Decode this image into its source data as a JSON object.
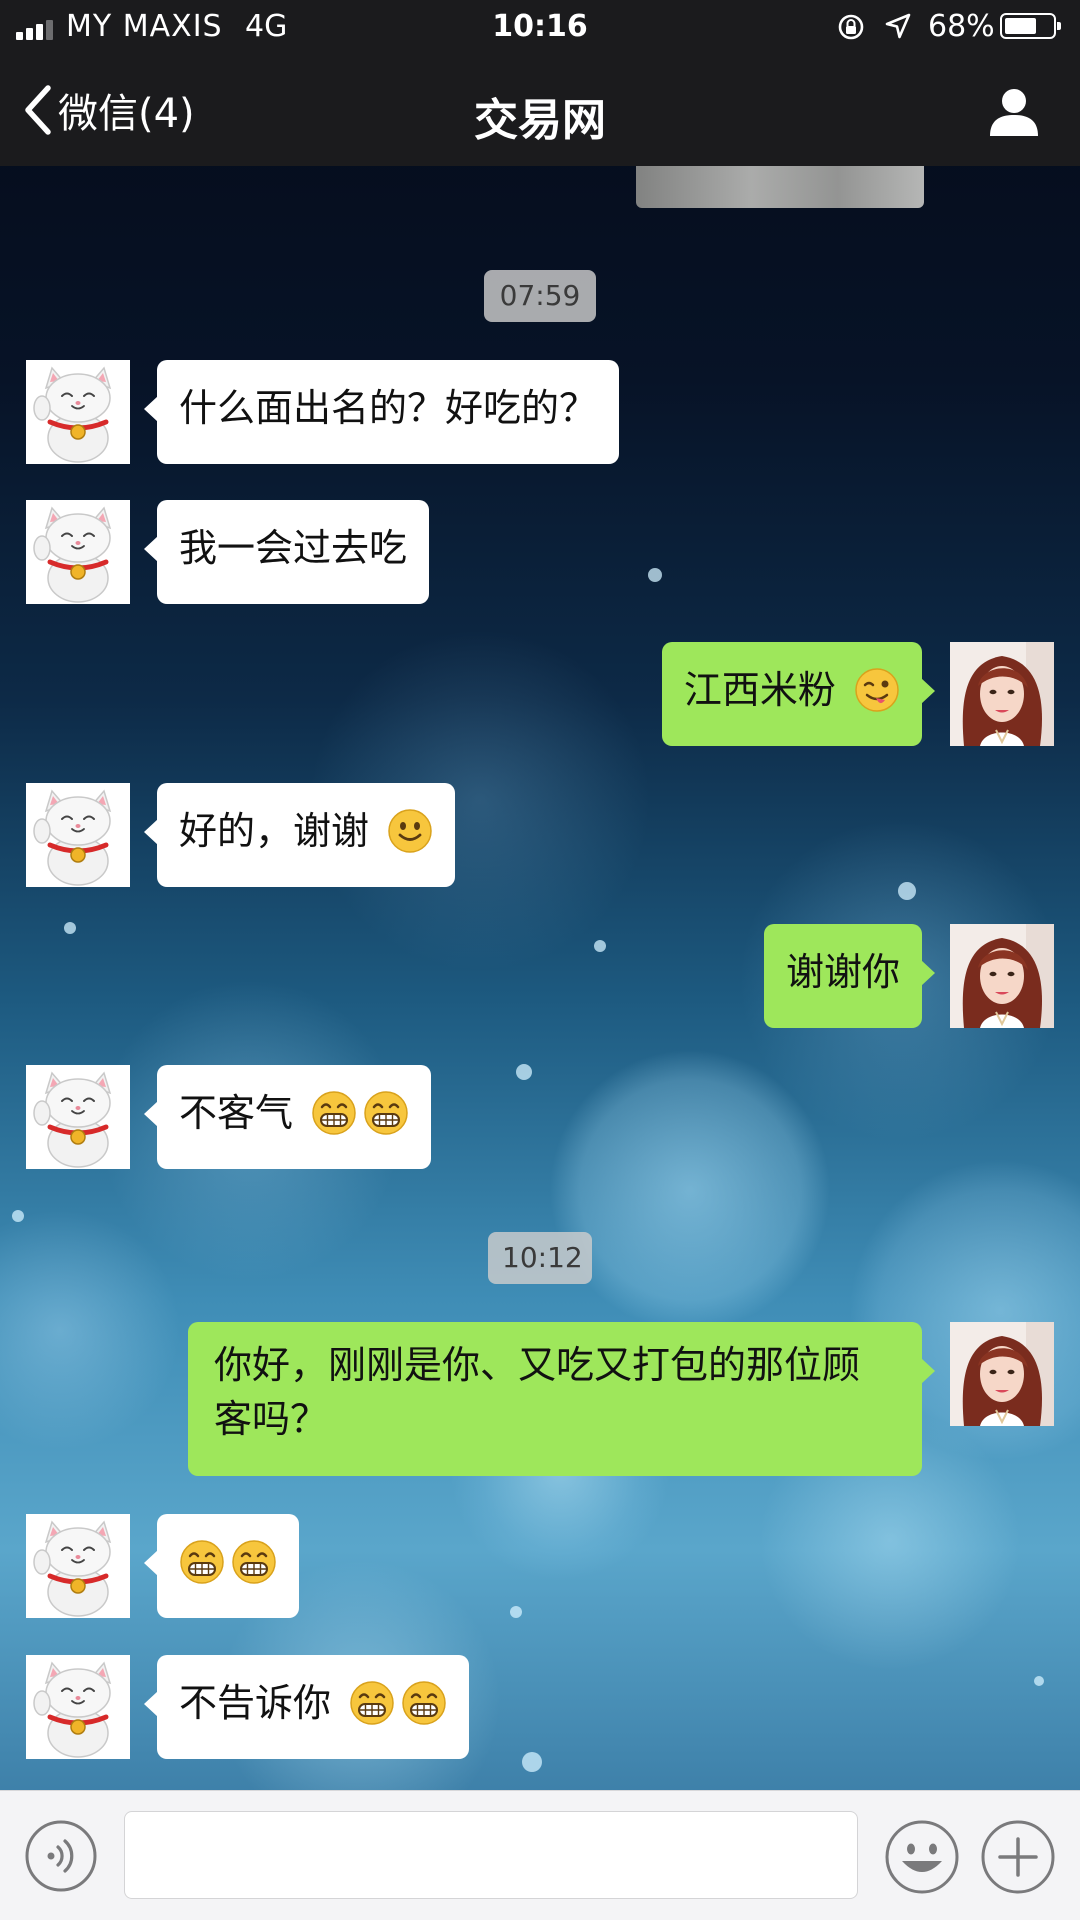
{
  "status_bar": {
    "carrier": "MY MAXIS",
    "network": "4G",
    "time": "10:16",
    "battery_percent": "68%",
    "battery_level": 0.68
  },
  "nav": {
    "back_label": "微信(4)",
    "title": "交易网"
  },
  "colors": {
    "bar_background": "#1b1b1d",
    "outgoing_bubble": "#9ee75b",
    "incoming_bubble": "#ffffff"
  },
  "timestamps": [
    "07:59",
    "10:12"
  ],
  "messages": [
    {
      "sender": "contact",
      "text": "什么面出名的？好吃的？",
      "emojis": []
    },
    {
      "sender": "contact",
      "text": "我一会过去吃",
      "emojis": []
    },
    {
      "sender": "me",
      "text": "江西米粉",
      "emojis": [
        "wink-tongue-emoji"
      ]
    },
    {
      "sender": "contact",
      "text": "好的，谢谢",
      "emojis": [
        "smile-emoji"
      ]
    },
    {
      "sender": "me",
      "text": "谢谢你",
      "emojis": []
    },
    {
      "sender": "contact",
      "text": "不客气",
      "emojis": [
        "grin-emoji",
        "grin-emoji"
      ]
    },
    {
      "sender": "me",
      "text": "你好，刚刚是你、又吃又打包的那位顾客吗？",
      "emojis": []
    },
    {
      "sender": "contact",
      "text": "",
      "emojis": [
        "grin-emoji",
        "grin-emoji"
      ]
    },
    {
      "sender": "contact",
      "text": "不告诉你",
      "emojis": [
        "grin-emoji",
        "grin-emoji"
      ]
    }
  ],
  "input": {
    "value": "",
    "placeholder": ""
  },
  "icons": {
    "back": "chevron-left-icon",
    "contact": "person-icon",
    "voice": "voice-icon",
    "emoji": "emoji-icon",
    "more": "plus-icon",
    "contact_avatar": "lucky-cat-avatar",
    "my_avatar": "woman-avatar"
  }
}
